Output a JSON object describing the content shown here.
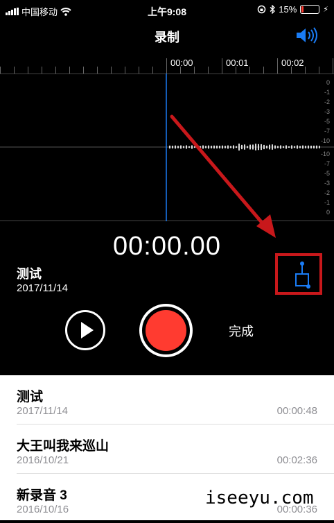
{
  "status_bar": {
    "carrier": "中国移动",
    "time": "上午9:08",
    "battery": "15%",
    "battery_level": 0.15
  },
  "header": {
    "title": "录制"
  },
  "ruler": {
    "labels": [
      "00:00",
      "00:01",
      "00:02"
    ]
  },
  "waveform": {
    "db_scale": [
      "0",
      "-1",
      "-2",
      "-3",
      "-5",
      "-7",
      "-10",
      "-10",
      "-7",
      "-5",
      "-3",
      "-2",
      "-1",
      "0"
    ]
  },
  "recorder": {
    "timer": "00:00.00",
    "name": "测试",
    "date": "2017/11/14",
    "done_label": "完成"
  },
  "recordings": [
    {
      "name": "测试",
      "date": "2017/11/14",
      "duration": "00:00:48"
    },
    {
      "name": "大王叫我来巡山",
      "date": "2016/10/21",
      "duration": "00:02:36"
    },
    {
      "name": "新录音 3",
      "date": "2016/10/16",
      "duration": "00:00:36"
    }
  ],
  "watermark": "iseeyu.com",
  "colors": {
    "accent": "#1a7cf5",
    "record": "#ff3b30",
    "highlight": "#c8181b"
  }
}
